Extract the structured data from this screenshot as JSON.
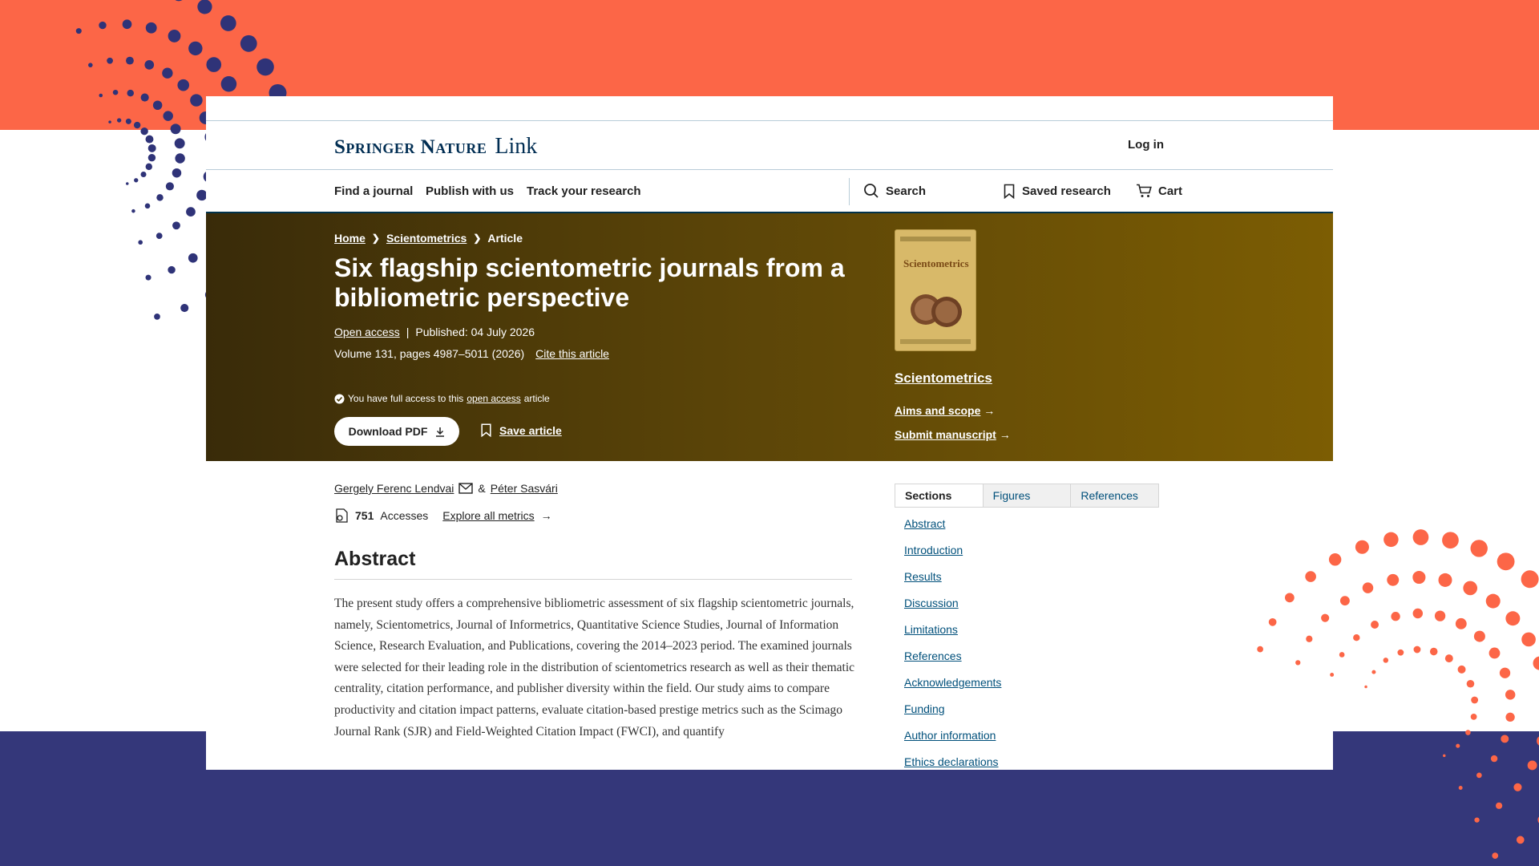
{
  "colors": {
    "accent_orange": "#FC6647",
    "accent_navy": "#34377A",
    "hero_gold": "#6b5006",
    "link_blue": "#01507b"
  },
  "header": {
    "brand_main": "Springer Nature",
    "brand_link": "Link",
    "login": "Log in"
  },
  "nav": {
    "find_journal": "Find a journal",
    "publish": "Publish with us",
    "track": "Track your research",
    "search": "Search",
    "saved": "Saved research",
    "cart": "Cart"
  },
  "breadcrumb": {
    "home": "Home",
    "journal": "Scientometrics",
    "current": "Article"
  },
  "article": {
    "title": "Six flagship scientometric journals from a bibliometric perspective",
    "open_access": "Open access",
    "published": "Published: 04 July 2026",
    "volume": "Volume 131, pages 4987–5011 (2026)",
    "cite": "Cite this article",
    "access_prefix": "You have full access to this",
    "access_link": "open access",
    "access_suffix": "article",
    "download": "Download PDF",
    "save": "Save article"
  },
  "journal": {
    "cover_title": "Scientometrics",
    "name": "Scientometrics",
    "aims": "Aims and scope",
    "submit": "Submit manuscript"
  },
  "authors": {
    "first": "Gergely Ferenc Lendvai",
    "amp": "&",
    "second": "Péter Sasvári"
  },
  "metrics": {
    "count": "751",
    "label": "Accesses",
    "explore": "Explore all metrics"
  },
  "abstract": {
    "heading": "Abstract",
    "text": "The present study offers a comprehensive bibliometric assessment of six flagship scientometric journals, namely, Scientometrics, Journal of Informetrics, Quantitative Science Studies, Journal of Information Science, Research Evaluation, and Publications, covering the 2014–2023 period. The examined journals were selected for their leading role in the distribution of scientometrics research as well as their thematic centrality, citation performance, and publisher diversity within the field. Our study aims to compare productivity and citation impact patterns, evaluate citation-based prestige metrics such as the Scimago Journal Rank (SJR) and Field-Weighted Citation Impact (FWCI), and quantify"
  },
  "sidebar": {
    "tabs": [
      "Sections",
      "Figures",
      "References"
    ],
    "sections": [
      "Abstract",
      "Introduction",
      "Results",
      "Discussion",
      "Limitations",
      "References",
      "Acknowledgements",
      "Funding",
      "Author information",
      "Ethics declarations"
    ]
  },
  "icons": [
    "search-icon",
    "bookmark-icon",
    "cart-icon",
    "download-icon",
    "check-circle-icon",
    "mail-icon",
    "metrics-icon",
    "arrow-right-icon"
  ]
}
